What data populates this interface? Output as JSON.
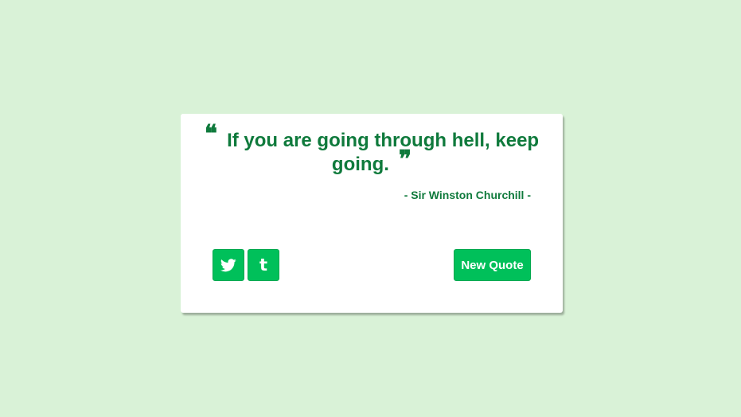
{
  "quote": {
    "open_mark": "❝",
    "text": "If you are going through hell, keep going.",
    "close_mark": "❞",
    "author": "- Sir Winston Churchill -"
  },
  "actions": {
    "twitter_icon": "twitter-icon",
    "tumblr_icon": "tumblr-icon",
    "tumblr_glyph": "t",
    "new_quote_label": "New Quote"
  },
  "colors": {
    "background": "#d9f2d7",
    "accent_text": "#0f7a3c",
    "button": "#00c05a"
  }
}
